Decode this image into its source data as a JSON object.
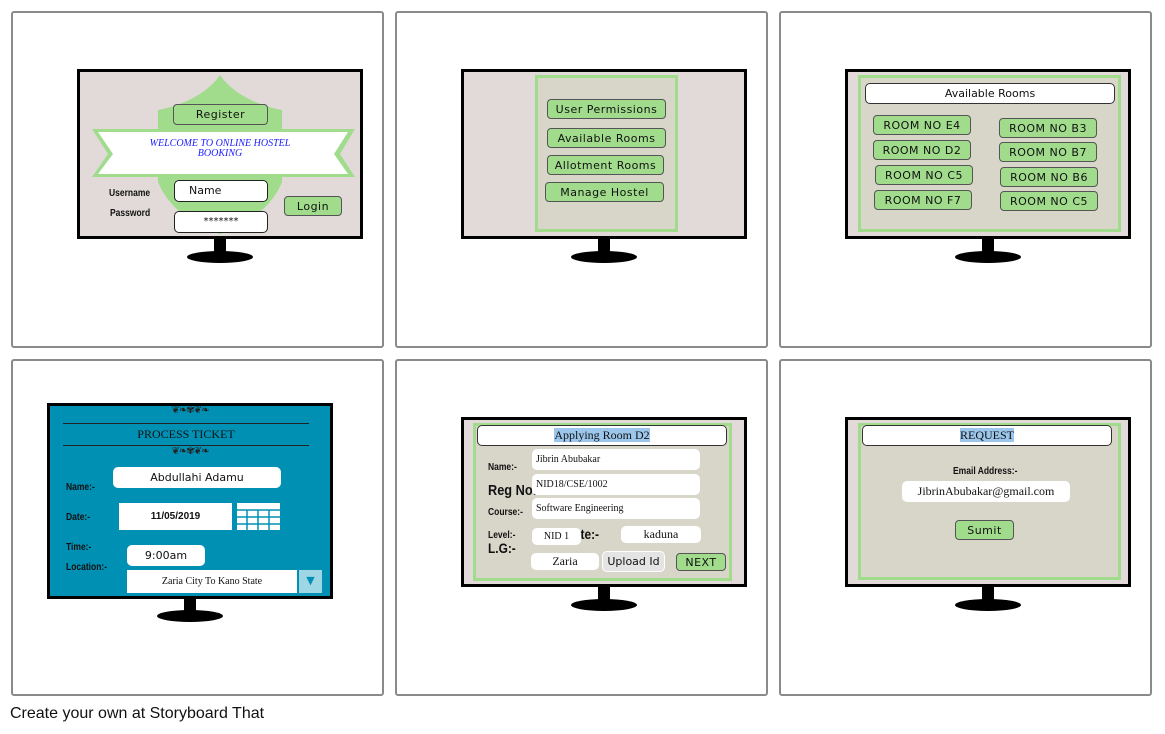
{
  "panel1": {
    "register": "Register",
    "welcome": "WELCOME TO  ONLINE HOSTEL BOOKING",
    "username_label": "Username",
    "password_label": "Password",
    "username_value": "Name",
    "password_value": "*******",
    "login": "Login"
  },
  "panel2": {
    "menu": [
      "User Permissions",
      "Available Rooms",
      "Allotment Rooms",
      "Manage Hostel"
    ]
  },
  "panel3": {
    "title": "Available Rooms",
    "rooms_left": [
      "ROOM NO E4",
      "ROOM NO D2",
      "ROOM NO C5",
      "ROOM NO F7"
    ],
    "rooms_right": [
      "ROOM NO B3",
      "ROOM NO B7",
      "ROOM NO B6",
      "ROOM NO C5"
    ]
  },
  "panel4": {
    "title": "PROCESS TICKET",
    "name_label": "Name:-",
    "name_value": "Abdullahi Adamu",
    "date_label": "Date:-",
    "date_value": "11/05/2019",
    "time_label": "Time:-",
    "time_value": "9:00am",
    "location_label": "Location:-",
    "location_value": "Zaria City To Kano State",
    "bg": "#0090b4"
  },
  "panel5": {
    "title": "Applying Room D2",
    "name_label": "Name:-",
    "name_value": "Jibrin Abubakar",
    "reg_label": "Reg No:-",
    "reg_value": "NID18/CSE/1002",
    "course_label": "Course:-",
    "course_value": "Software Engineering",
    "level_label": "Level:-",
    "level_value": "NID 1",
    "state_label": "State:-",
    "state_value": "kaduna",
    "lg_label": "L.G:-",
    "lg_value": "Zaria",
    "upload": "Upload Id",
    "next": "NEXT"
  },
  "panel6": {
    "title": "REQUEST",
    "email_label": "Email Address:-",
    "email_value": "JibrinAbubakar@gmail.com",
    "submit": "Sumit"
  },
  "footer": "Create your own at Storyboard That"
}
